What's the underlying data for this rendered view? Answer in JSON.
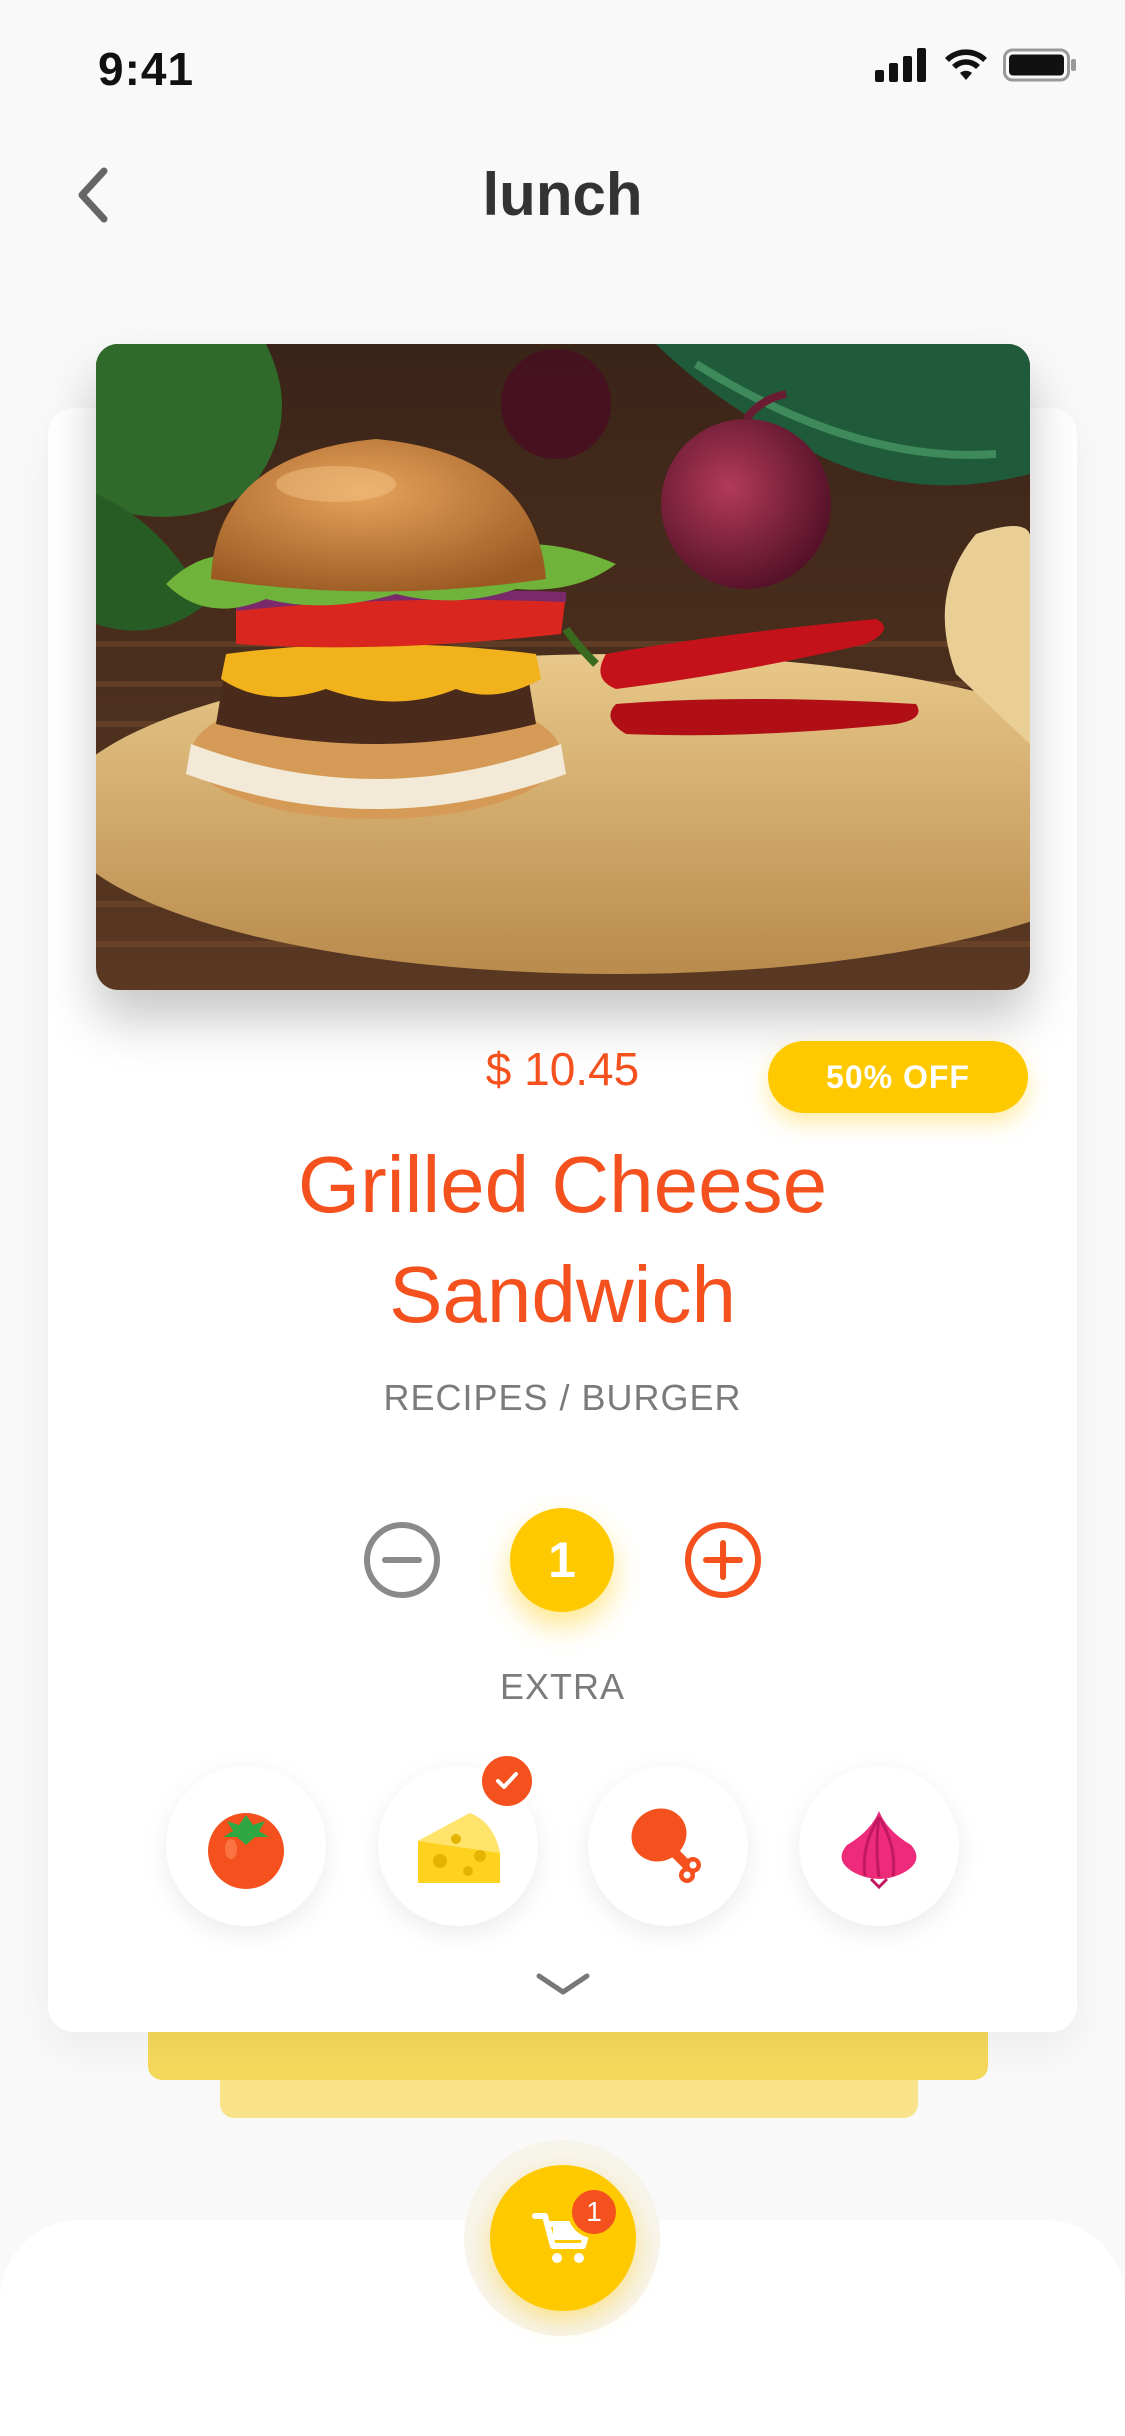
{
  "status_bar": {
    "time": "9:41",
    "icons": [
      "signal-icon",
      "wifi-icon",
      "battery-icon"
    ]
  },
  "header": {
    "back_icon": "chevron-left-icon",
    "title": "lunch"
  },
  "product": {
    "image": "burger-photo",
    "price": "$ 10.45",
    "discount_badge": "50% OFF",
    "title_line1": "Grilled Cheese",
    "title_line2": "Sandwich",
    "breadcrumb": "RECIPES / BURGER"
  },
  "quantity": {
    "value": "1",
    "minus_icon": "minus-circle-icon",
    "plus_icon": "plus-circle-icon"
  },
  "extras": {
    "label": "EXTRA",
    "items": [
      {
        "icon": "tomato-icon",
        "selected": false
      },
      {
        "icon": "cheese-icon",
        "selected": true
      },
      {
        "icon": "chicken-leg-icon",
        "selected": false
      },
      {
        "icon": "onion-icon",
        "selected": false
      }
    ],
    "expand_icon": "chevron-down-icon"
  },
  "cart": {
    "icon": "cart-icon",
    "count": "1"
  },
  "colors": {
    "accent_orange": "#f4511e",
    "accent_yellow": "#ffc900",
    "text_gray": "#7b7b7b"
  }
}
